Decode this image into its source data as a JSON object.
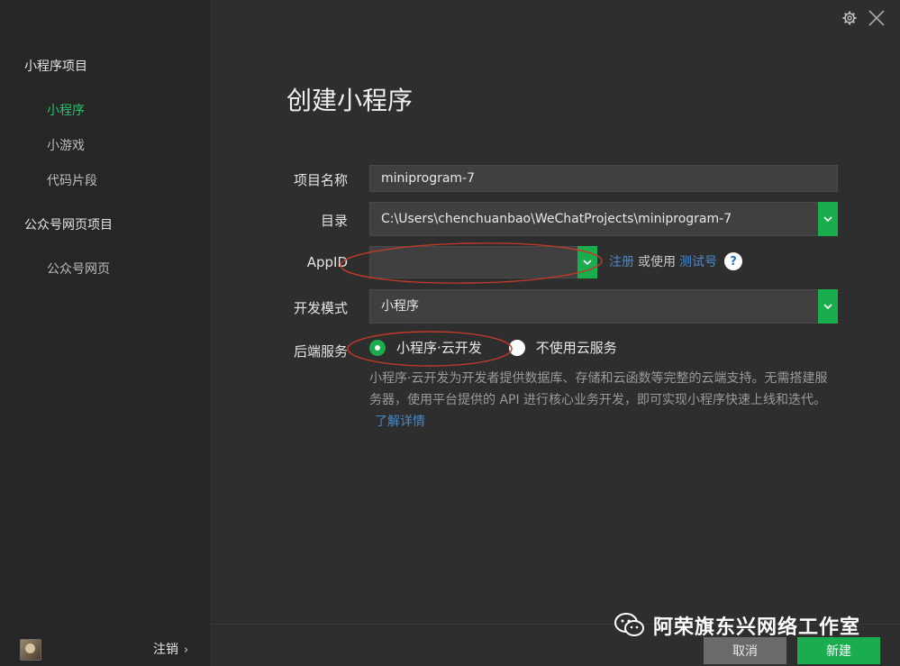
{
  "sidebar": {
    "group1": "小程序项目",
    "items1": [
      "小程序",
      "小游戏",
      "代码片段"
    ],
    "group2": "公众号网页项目",
    "items2": [
      "公众号网页"
    ],
    "logout": "注销"
  },
  "header": {
    "icons": [
      "gear-icon",
      "close-icon"
    ]
  },
  "form": {
    "title": "创建小程序",
    "project_name_label": "项目名称",
    "project_name_value": "miniprogram-7",
    "directory_label": "目录",
    "directory_value": "C:\\Users\\chenchuanbao\\WeChatProjects\\miniprogram-7",
    "appid_label": "AppID",
    "appid_value": "",
    "appid_register": "注册",
    "appid_or_use": "或使用",
    "appid_test": "测试号",
    "appid_help": "?",
    "devmode_label": "开发模式",
    "devmode_value": "小程序",
    "backend_label": "后端服务",
    "backend_options": [
      "小程序·云开发",
      "不使用云服务"
    ],
    "backend_desc": "小程序·云开发为开发者提供数据库、存储和云函数等完整的云端支持。无需搭建服务器，使用平台提供的 API 进行核心业务开发，即可实现小程序快速上线和迭代。",
    "learn_more": "了解详情"
  },
  "footer": {
    "cancel": "取消",
    "create": "新建"
  },
  "watermark": "阿荣旗东兴网络工作室",
  "colors": {
    "accent": "#1aad4e",
    "active_text": "#21c46a",
    "link": "#4c88c8",
    "annotation": "#c0392b"
  }
}
